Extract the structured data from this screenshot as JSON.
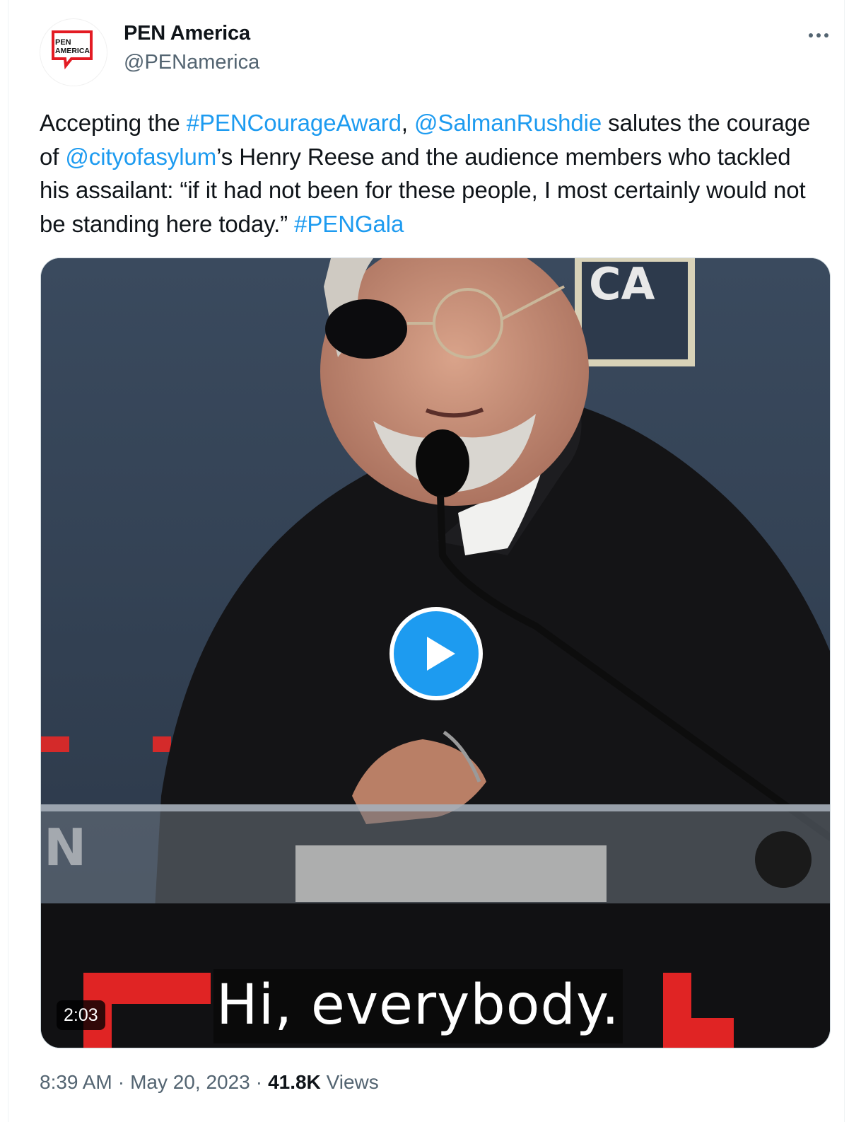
{
  "author": {
    "display_name": "PEN America",
    "handle": "@PENamerica",
    "logo_text_1": "PEN",
    "logo_text_2": "AMERICA",
    "brand_color": "#e31b23"
  },
  "tweet": {
    "segments": [
      {
        "text": "Accepting the ",
        "link": false
      },
      {
        "text": "#PENCourageAward",
        "link": true
      },
      {
        "text": ", ",
        "link": false
      },
      {
        "text": "@SalmanRushdie",
        "link": true
      },
      {
        "text": " salutes the courage of ",
        "link": false
      },
      {
        "text": "@cityofasylum",
        "link": true
      },
      {
        "text": "’s Henry Reese and the audience members who tackled his assailant: “if it had not been for these people, I most certainly would not be standing here today.” ",
        "link": false
      },
      {
        "text": "#PENGala",
        "link": true
      }
    ],
    "link_color": "#1d9bf0"
  },
  "media": {
    "type": "video",
    "duration": "2:03",
    "caption": "Hi, everybody.",
    "backdrop_text_top": "CA",
    "backdrop_text_left": "N",
    "play_icon": "play-icon",
    "play_color": "#1d9bf0"
  },
  "meta": {
    "time": "8:39 AM",
    "separator": "·",
    "date": "May 20, 2023",
    "views_count": "41.8K",
    "views_label": "Views"
  },
  "icons": {
    "more": "more-horizontal-icon"
  }
}
